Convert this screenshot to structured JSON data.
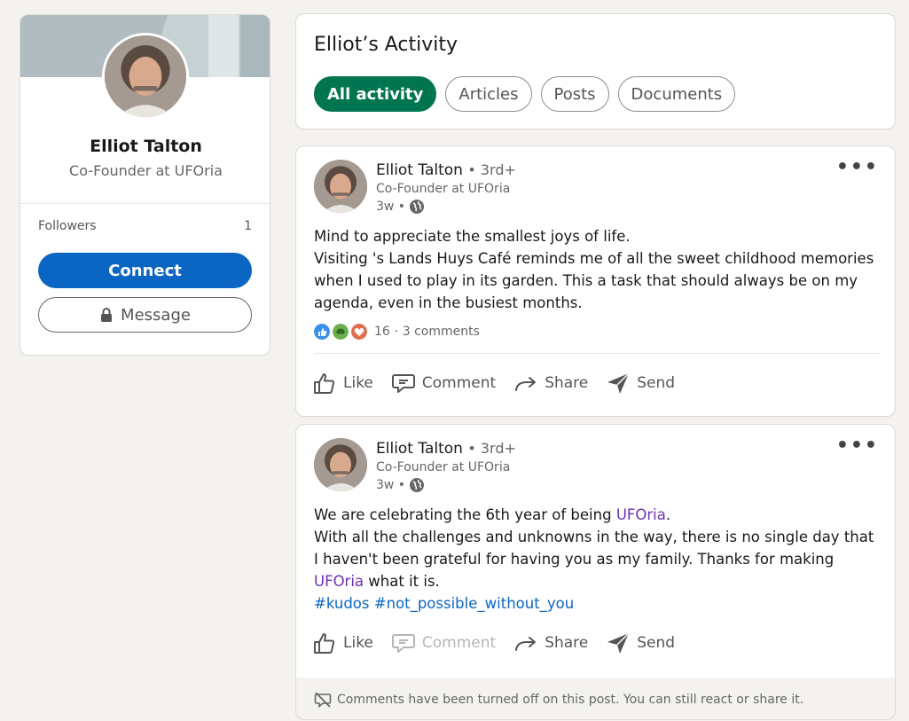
{
  "profile": {
    "name": "Elliot Talton",
    "headline": "Co-Founder at UFOria",
    "followers_label": "Followers",
    "followers_count": "1",
    "connect_label": "Connect",
    "message_label": "Message"
  },
  "activity": {
    "title": "Elliot’s Activity",
    "tabs": [
      {
        "label": "All activity",
        "active": true
      },
      {
        "label": "Articles",
        "active": false
      },
      {
        "label": "Posts",
        "active": false
      },
      {
        "label": "Documents",
        "active": false
      }
    ]
  },
  "posts": [
    {
      "author": "Elliot Talton",
      "degree": "• 3rd+",
      "headline": "Co-Founder at UFOria",
      "time": "3w •",
      "line1": "Mind to appreciate the smallest joys of life.",
      "line2": "Visiting 's Lands Huys Café reminds me of all the sweet childhood memories when I used to play in its garden. This a task that should always be on my agenda, even in the busiest months.",
      "reaction_count": "16",
      "comments": "· 3 comments",
      "actions": {
        "like": "Like",
        "comment": "Comment",
        "share": "Share",
        "send": "Send"
      }
    },
    {
      "author": "Elliot Talton",
      "degree": "• 3rd+",
      "headline": "Co-Founder at UFOria",
      "time": "3w •",
      "line1_pre": "We are celebrating the 6th year of being ",
      "mention": "UFOria",
      "line1_post": ".",
      "line2_pre": "With all the challenges and unknowns in the way, there is no single day that I haven't been grateful for having you as my family. Thanks for making ",
      "line2_post": " what it is.",
      "hashtags": "#kudos #not_possible_without_you",
      "actions": {
        "like": "Like",
        "comment": "Comment",
        "share": "Share",
        "send": "Send"
      },
      "comments_disabled_note": "Comments have been turned off on this post. You can still react or share it."
    }
  ],
  "colors": {
    "primary": "#0a66c2",
    "active_tab": "#01754f",
    "mention": "#6e2fb5"
  }
}
